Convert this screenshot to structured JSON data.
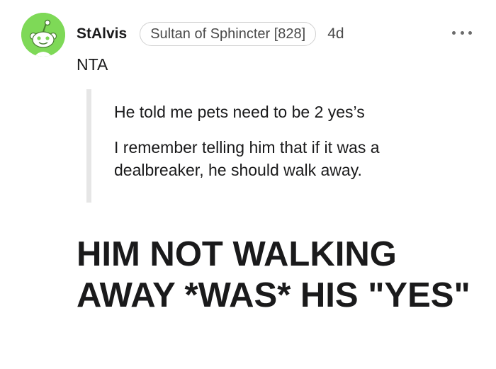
{
  "comment": {
    "author": "StAlvis",
    "flair": "Sultan of Sphincter [828]",
    "age": "4d",
    "avatar_icon": "reddit-snoo-icon",
    "more_icon": "more-options-icon",
    "verdict": "NTA",
    "quote_lines": [
      "He told me pets need to be 2 yes’s",
      "I remember telling him that if it was a dealbreaker, he should walk away."
    ],
    "heading": "HIM NOT WALKING AWAY *WAS* HIS \"YES\""
  },
  "colors": {
    "avatar_bg": "#7ed957",
    "text": "#1a1a1b",
    "muted": "#4a4a4a",
    "quote_bar": "#e6e6e6"
  }
}
